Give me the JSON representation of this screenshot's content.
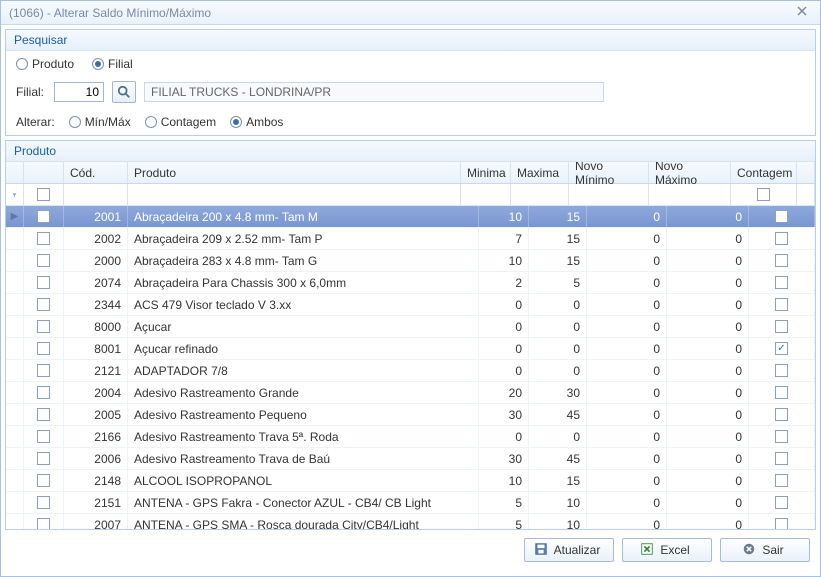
{
  "window": {
    "title": "(1066) - Alterar Saldo Mínimo/Máximo"
  },
  "search": {
    "panel_title": "Pesquisar",
    "mode_options": {
      "produto": "Produto",
      "filial": "Filial"
    },
    "mode_selected": "filial",
    "filial_label": "Filial:",
    "filial_value": "10",
    "filial_name": "FILIAL TRUCKS - LONDRINA/PR",
    "alterar_label": "Alterar:",
    "alterar_options": {
      "minmax": "Mín/Máx",
      "contagem": "Contagem",
      "ambos": "Ambos"
    },
    "alterar_selected": "ambos"
  },
  "grid": {
    "panel_title": "Produto",
    "columns": {
      "cod": "Cód.",
      "produto": "Produto",
      "minima": "Minima",
      "maxima": "Maxima",
      "novo_minimo": "Novo Mínimo",
      "novo_maximo": "Novo Máximo",
      "contagem": "Contagem"
    },
    "selected_index": 0,
    "rows": [
      {
        "cod": "2001",
        "produto": "Abraçadeira 200 x 4.8 mm- Tam M",
        "min": "10",
        "max": "15",
        "nmin": "0",
        "nmax": "0",
        "contagem": false
      },
      {
        "cod": "2002",
        "produto": "Abraçadeira 209 x 2.52 mm- Tam P",
        "min": "7",
        "max": "15",
        "nmin": "0",
        "nmax": "0",
        "contagem": false
      },
      {
        "cod": "2000",
        "produto": "Abraçadeira 283 x 4.8 mm- Tam G",
        "min": "10",
        "max": "15",
        "nmin": "0",
        "nmax": "0",
        "contagem": false
      },
      {
        "cod": "2074",
        "produto": "Abraçadeira Para Chassis  300 x 6,0mm",
        "min": "2",
        "max": "5",
        "nmin": "0",
        "nmax": "0",
        "contagem": false
      },
      {
        "cod": "2344",
        "produto": "ACS 479 Visor teclado V 3.xx",
        "min": "0",
        "max": "0",
        "nmin": "0",
        "nmax": "0",
        "contagem": false
      },
      {
        "cod": "8000",
        "produto": "Açucar",
        "min": "0",
        "max": "0",
        "nmin": "0",
        "nmax": "0",
        "contagem": false
      },
      {
        "cod": "8001",
        "produto": "Açucar refinado",
        "min": "0",
        "max": "0",
        "nmin": "0",
        "nmax": "0",
        "contagem": true
      },
      {
        "cod": "2121",
        "produto": "ADAPTADOR 7/8",
        "min": "0",
        "max": "0",
        "nmin": "0",
        "nmax": "0",
        "contagem": false
      },
      {
        "cod": "2004",
        "produto": "Adesivo Rastreamento Grande",
        "min": "20",
        "max": "30",
        "nmin": "0",
        "nmax": "0",
        "contagem": false
      },
      {
        "cod": "2005",
        "produto": "Adesivo Rastreamento Pequeno",
        "min": "30",
        "max": "45",
        "nmin": "0",
        "nmax": "0",
        "contagem": false
      },
      {
        "cod": "2166",
        "produto": "Adesivo Rastreamento Trava 5ª. Roda",
        "min": "0",
        "max": "0",
        "nmin": "0",
        "nmax": "0",
        "contagem": false
      },
      {
        "cod": "2006",
        "produto": "Adesivo Rastreamento Trava de Baú",
        "min": "30",
        "max": "45",
        "nmin": "0",
        "nmax": "0",
        "contagem": false
      },
      {
        "cod": "2148",
        "produto": "ALCOOL ISOPROPANOL",
        "min": "10",
        "max": "15",
        "nmin": "0",
        "nmax": "0",
        "contagem": false
      },
      {
        "cod": "2151",
        "produto": "ANTENA - GPS Fakra - Conector AZUL - CB4/ CB Light",
        "min": "5",
        "max": "10",
        "nmin": "0",
        "nmax": "0",
        "contagem": false
      },
      {
        "cod": "2007",
        "produto": "ANTENA - GPS SMA - Rosca dourada City/CB4/Light",
        "min": "5",
        "max": "10",
        "nmin": "0",
        "nmax": "0",
        "contagem": false
      }
    ]
  },
  "footer": {
    "atualizar": "Atualizar",
    "excel": "Excel",
    "sair": "Sair"
  }
}
